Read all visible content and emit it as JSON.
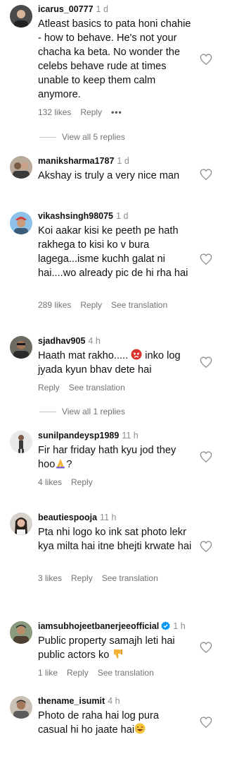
{
  "comments": [
    {
      "username": "icarus_00777",
      "time": "1 d",
      "text": "Atleast basics to pata honi chahie - how to behave. He's not your chacha ka beta. No wonder the celebs behave rude at times unable to keep them calm anymore.",
      "likes": "132 likes",
      "reply": "Reply",
      "more": "•••",
      "view_replies": "View all 5 replies"
    },
    {
      "username": "maniksharma1787",
      "time": "1 d",
      "text": "Akshay is truly a very nice man"
    },
    {
      "username": "vikashsingh98075",
      "time": "1 d",
      "text": "Koi aakar kisi ke peeth pe hath rakhega to kisi ko v bura lagega...isme kuchh galat ni hai....wo already pic de hi rha hai",
      "likes": "289 likes",
      "reply": "Reply",
      "translate": "See translation"
    },
    {
      "username": "sjadhav905",
      "time": "4 h",
      "text_before": "Haath mat rakho..... ",
      "emoji": "angry-face",
      "text_after": " inko log jyada kyun bhav dete hai",
      "reply": "Reply",
      "translate": "See translation",
      "view_replies": "View all 1 replies"
    },
    {
      "username": "sunilpandeysp1989",
      "time": "11 h",
      "text_before": "Fir har friday hath kyu jod they hoo",
      "emoji": "folded-hands",
      "text_after": "?",
      "likes": "4 likes",
      "reply": "Reply"
    },
    {
      "username": "beautiespooja",
      "time": "11 h",
      "text": "Pta nhi logo ko ink sat photo lekr kya milta hai itne bhejti krwate hai",
      "likes": "3 likes",
      "reply": "Reply",
      "translate": "See translation"
    },
    {
      "username": "iamsubhojeetbanerjeeofficial",
      "time": "1 h",
      "verified": true,
      "text_before": "Public property samajh leti hai public actors ko ",
      "emoji": "thumbs-down",
      "likes": "1 like",
      "reply": "Reply",
      "translate": "See translation"
    },
    {
      "username": "thename_isumit",
      "time": "4 h",
      "text_before": "Photo de raha hai log pura casual hi ho jaate hai",
      "emoji": "laughing-face"
    }
  ],
  "colors": {
    "text": "#111111",
    "muted": "#737373",
    "verified": "#0095f6",
    "line": "#c7c7c7"
  }
}
